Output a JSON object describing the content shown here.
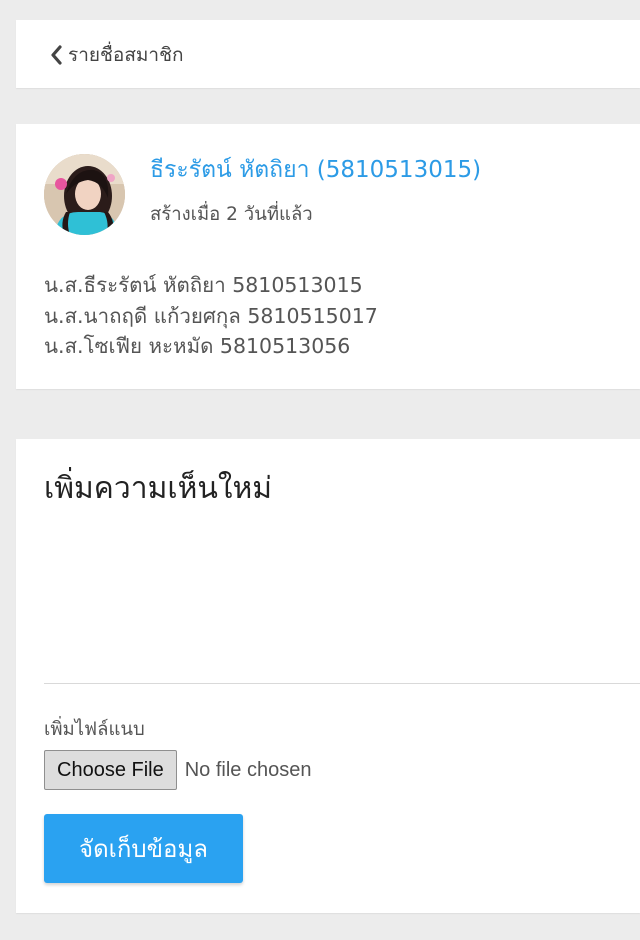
{
  "nav": {
    "back_label": "รายชื่อสมาชิก",
    "back_icon": "chevron-left-icon"
  },
  "post": {
    "author": "ธีระรัตน์ หัตถิยา (5810513015)",
    "created": "สร้างเมื่อ 2 วันที่แล้ว",
    "members": [
      "น.ส.ธีระรัตน์ หัตถิยา 5810513015",
      "น.ส.นาถฤดี แก้วยศกุล 5810515017",
      "น.ส.โซเฟีย หะหมัด 5810513056"
    ]
  },
  "comment": {
    "title": "เพิ่มความเห็นใหม่",
    "value": "",
    "attach_label": "เพิ่มไฟล์แนบ",
    "choose_file_label": "Choose File",
    "file_status": "No file chosen",
    "save_label": "จัดเก็บข้อมูล"
  },
  "colors": {
    "accent": "#2aa2f1",
    "link": "#2c9be6",
    "background": "#ececec"
  }
}
